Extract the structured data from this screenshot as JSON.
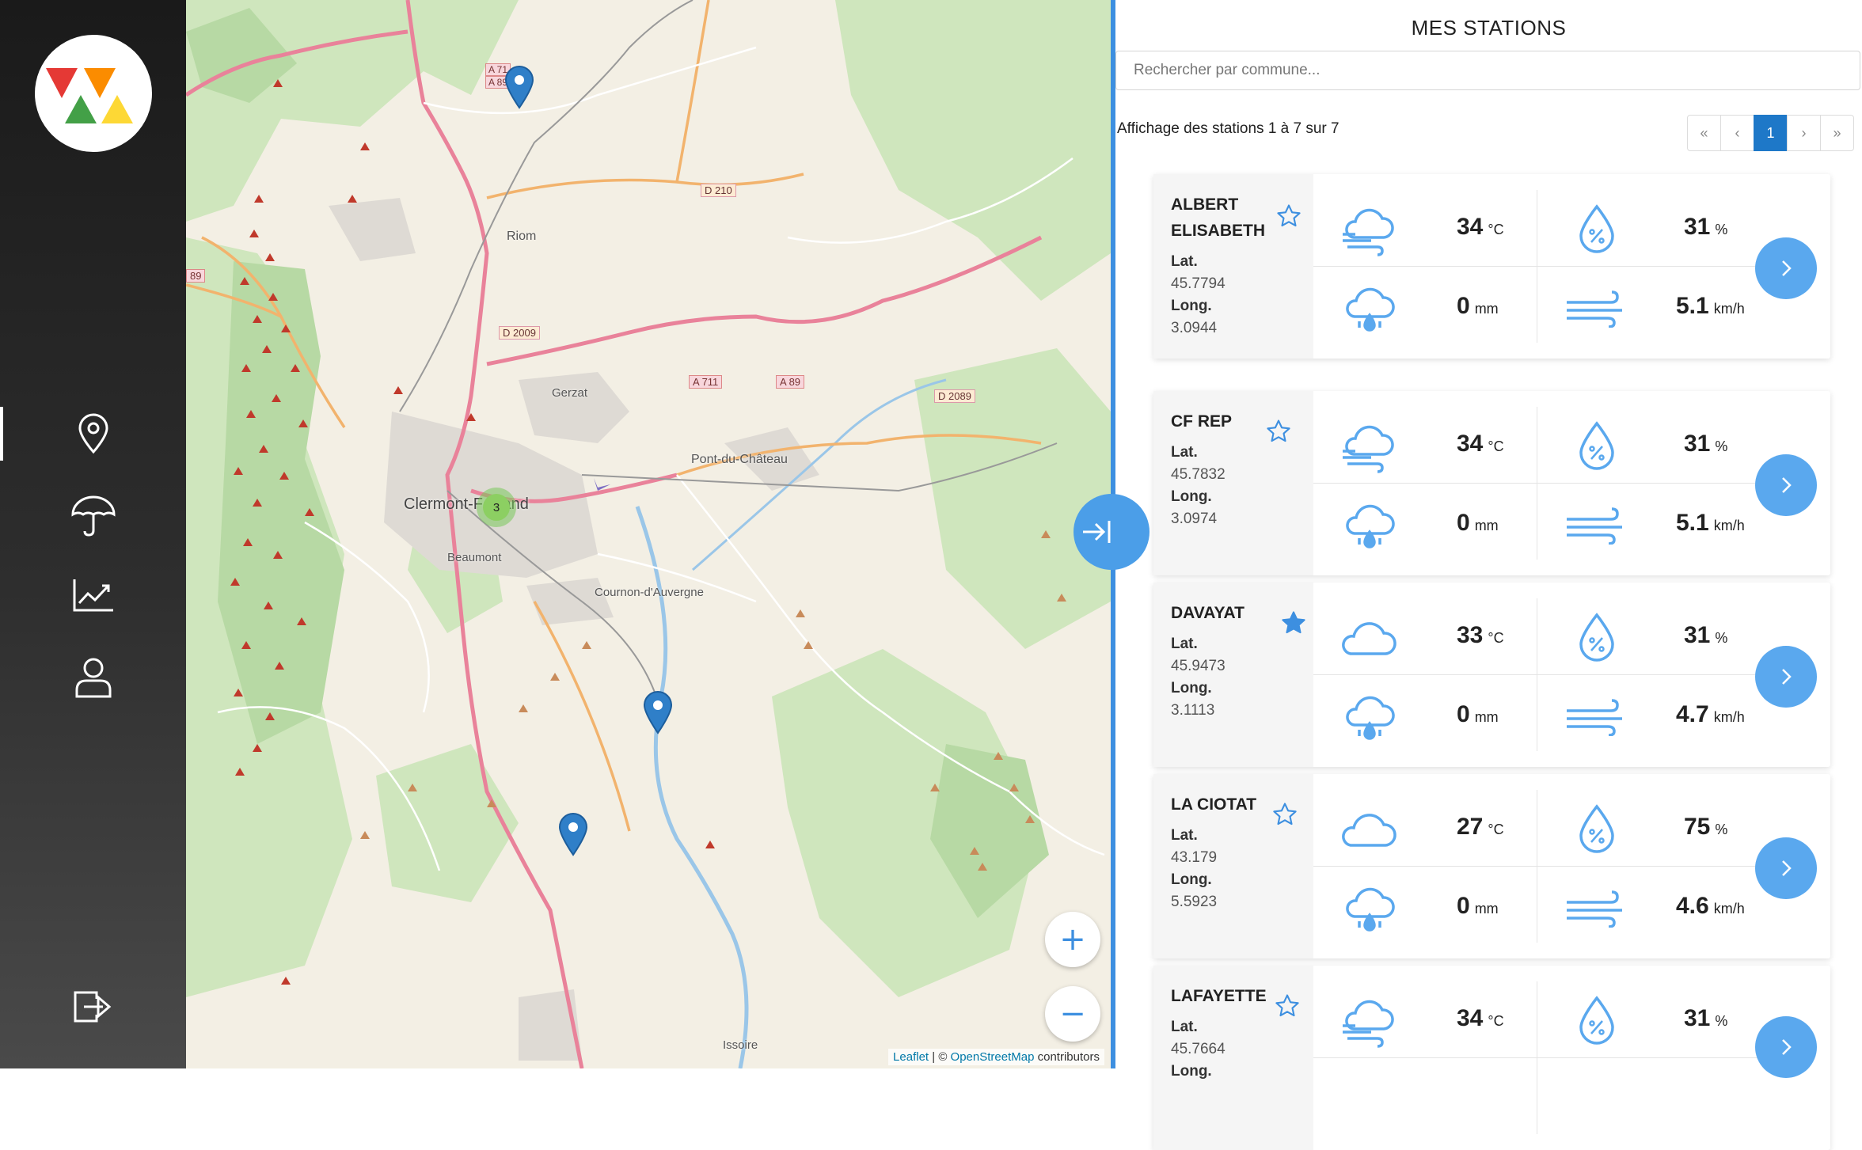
{
  "panel": {
    "title": "MES STATIONS",
    "search_placeholder": "Rechercher par commune...",
    "listing_text": "Affichage des stations 1 à 7 sur 7",
    "pagination": [
      "«",
      "‹",
      "1",
      "›",
      "»"
    ],
    "active_page": "1"
  },
  "map": {
    "labels": [
      {
        "text": "Riom"
      },
      {
        "text": "Gerzat"
      },
      {
        "text": "Clermont-Ferrand"
      },
      {
        "text": "Beaumont"
      },
      {
        "text": "Cournon-d'Auvergne"
      },
      {
        "text": "Pont-du-Château"
      },
      {
        "text": "Issoire"
      }
    ],
    "road_shields": [
      "A 71",
      "A 89",
      "D 210",
      "D 2009",
      "A 711",
      "A 89",
      "D 2089",
      "89"
    ],
    "cluster_count": "3",
    "zoom_in": "+",
    "zoom_out": "−",
    "attribution_leaflet": "Leaflet",
    "attribution_sep": " | © ",
    "attribution_osm": "OpenStreetMap",
    "attribution_tail": " contributors"
  },
  "stations": [
    {
      "name": "ALBERT ELISABETH",
      "favorite": false,
      "lat_label": "Lat.",
      "lat": "45.7794",
      "long_label": "Long.",
      "long": "3.0944",
      "weather_icon": "cloud-wind-icon",
      "temp": "34",
      "temp_unit": "°C",
      "humidity": "31",
      "humidity_unit": "%",
      "rain": "0",
      "rain_unit": "mm",
      "wind": "5.1",
      "wind_unit": "km/h"
    },
    {
      "name": "CF REP",
      "favorite": false,
      "lat_label": "Lat.",
      "lat": "45.7832",
      "long_label": "Long.",
      "long": "3.0974",
      "weather_icon": "cloud-wind-icon",
      "temp": "34",
      "temp_unit": "°C",
      "humidity": "31",
      "humidity_unit": "%",
      "rain": "0",
      "rain_unit": "mm",
      "wind": "5.1",
      "wind_unit": "km/h"
    },
    {
      "name": "DAVAYAT",
      "favorite": true,
      "lat_label": "Lat.",
      "lat": "45.9473",
      "long_label": "Long.",
      "long": "3.1113",
      "weather_icon": "cloud-icon",
      "temp": "33",
      "temp_unit": "°C",
      "humidity": "31",
      "humidity_unit": "%",
      "rain": "0",
      "rain_unit": "mm",
      "wind": "4.7",
      "wind_unit": "km/h"
    },
    {
      "name": "LA CIOTAT",
      "favorite": false,
      "lat_label": "Lat.",
      "lat": "43.179",
      "long_label": "Long.",
      "long": "5.5923",
      "weather_icon": "cloud-icon",
      "temp": "27",
      "temp_unit": "°C",
      "humidity": "75",
      "humidity_unit": "%",
      "rain": "0",
      "rain_unit": "mm",
      "wind": "4.6",
      "wind_unit": "km/h"
    },
    {
      "name": "LAFAYETTE",
      "favorite": false,
      "lat_label": "Lat.",
      "lat": "45.7664",
      "long_label": "Long.",
      "long": "",
      "weather_icon": "cloud-wind-icon",
      "temp": "34",
      "temp_unit": "°C",
      "humidity": "31",
      "humidity_unit": "%",
      "rain": "",
      "rain_unit": "",
      "wind": "",
      "wind_unit": ""
    }
  ],
  "colors": {
    "accent": "#3d8fe0",
    "icon_blue": "#5aa8ee",
    "active_page": "#1e78c8",
    "sidebar": "#1a1a1a",
    "favorite_star": "#3d8fe0"
  }
}
